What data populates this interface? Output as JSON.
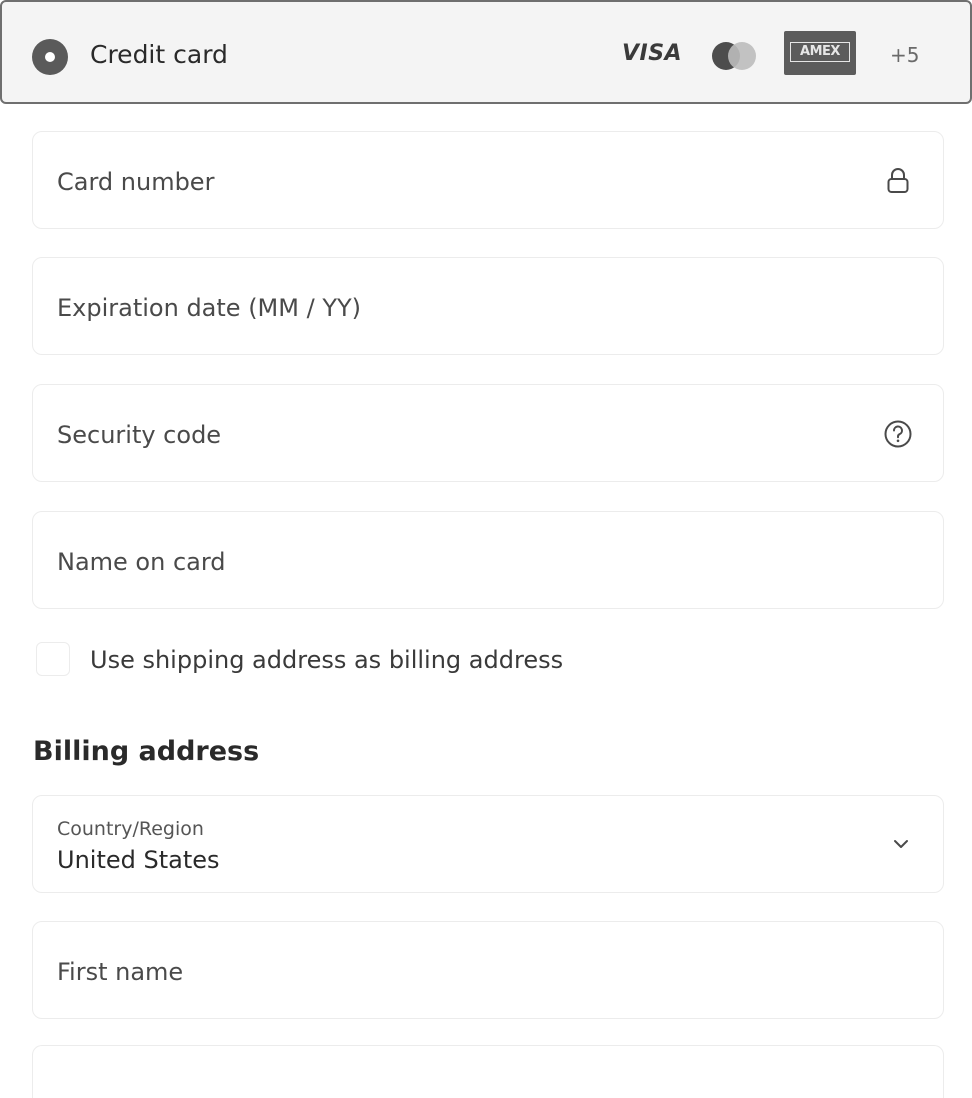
{
  "payment_method": {
    "label": "Credit card",
    "brands": {
      "visa": "VISA",
      "amex": "AMEX",
      "more": "+5"
    }
  },
  "fields": {
    "card_number": "Card number",
    "expiration": "Expiration date (MM / YY)",
    "security_code": "Security code",
    "name_on_card": "Name on card"
  },
  "billing_checkbox": {
    "label": "Use shipping address as billing address",
    "checked": false
  },
  "billing_address": {
    "title": "Billing address",
    "country_label": "Country/Region",
    "country_value": "United States",
    "first_name": "First name"
  },
  "icons": [
    "lock-icon",
    "help-circle-icon",
    "chevron-down-icon"
  ]
}
